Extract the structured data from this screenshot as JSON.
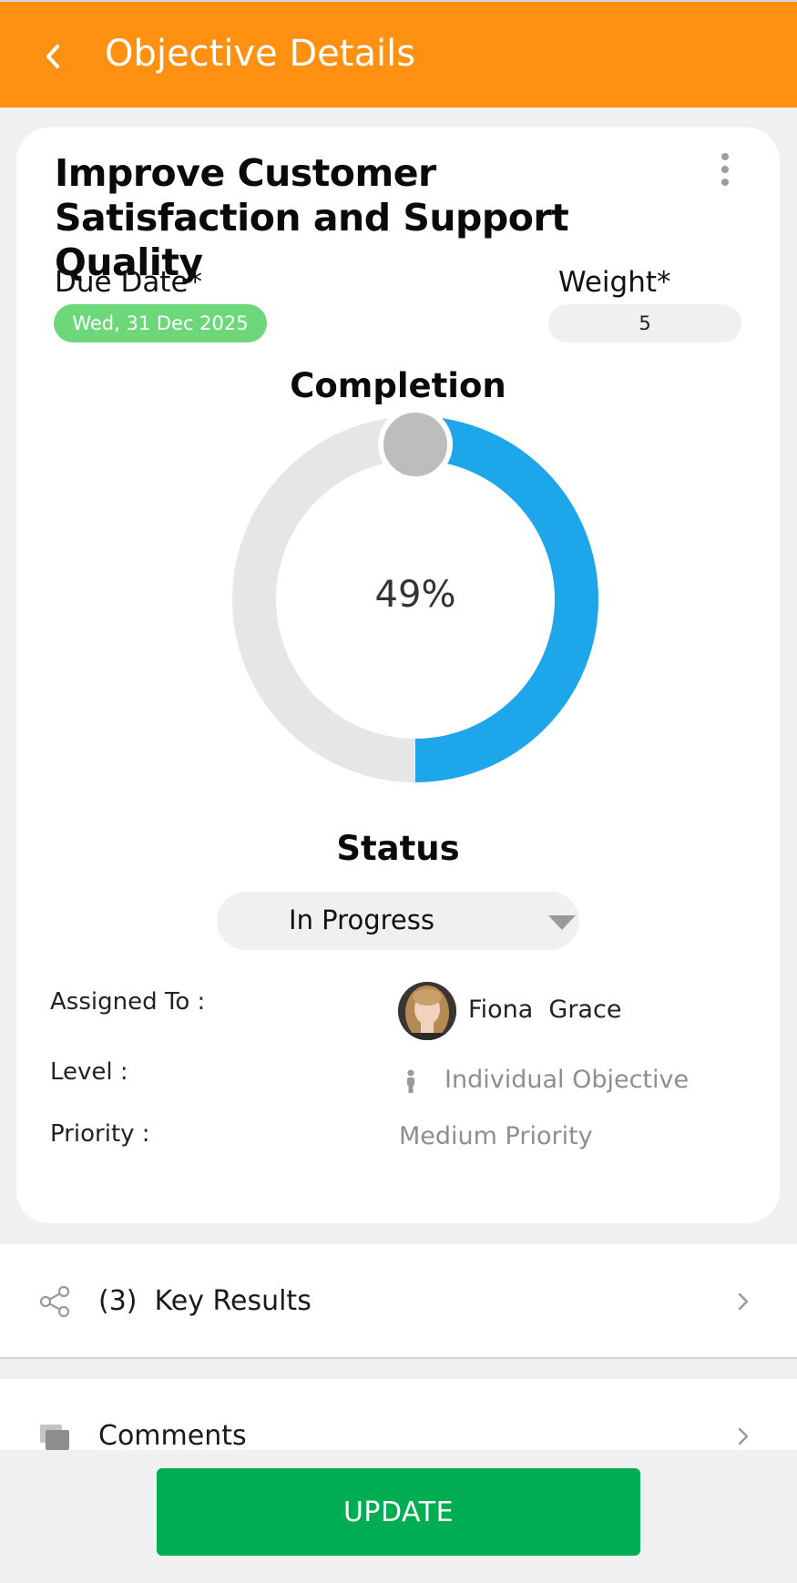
{
  "appbar": {
    "title": "Objective Details",
    "back_icon": "chevron-left-icon",
    "color": "#ff9112"
  },
  "objective": {
    "title": "Improve Customer Satisfaction and Support Quality",
    "due_date_label": "Due Date*",
    "due_date": "Wed, 31 Dec 2025",
    "weight_label": "Weight*",
    "weight": "5"
  },
  "completion": {
    "label": "Completion",
    "percent": 49,
    "percent_text": "49%",
    "fill_color": "#1da7ea",
    "track_color": "#e6e6e6"
  },
  "status": {
    "label": "Status",
    "value": "In Progress"
  },
  "details": {
    "assigned_label": "Assigned To :",
    "assignee": "Fiona  Grace",
    "level_label": "Level :",
    "level_value": "Individual Objective",
    "priority_label": "Priority :",
    "priority_value": "Medium Priority"
  },
  "sections": {
    "key_results_count": "(3)",
    "key_results": "(3)  Key Results",
    "comments": "Comments"
  },
  "actions": {
    "update": "UPDATE",
    "update_color": "#00ad52"
  }
}
